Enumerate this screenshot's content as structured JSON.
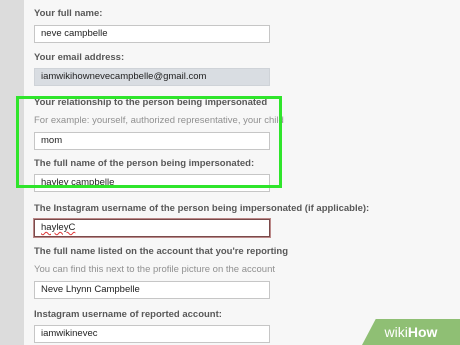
{
  "form": {
    "full_name": {
      "label": "Your full name:",
      "value": "neve campbelle"
    },
    "email": {
      "label": "Your email address:",
      "value": "iamwikihownevecampbelle@gmail.com"
    },
    "relationship": {
      "label": "Your relationship to the person being impersonated",
      "hint": "For example: yourself, authorized representative, your child",
      "value": "mom"
    },
    "impersonated_name": {
      "label": "The full name of the person being impersonated:",
      "value": "hayley campbelle"
    },
    "impersonated_username": {
      "label": "The Instagram username of the person being impersonated (if applicable):",
      "value": "hayleyC"
    },
    "reported_full_name": {
      "label": "The full name listed on the account that you're reporting",
      "hint": "You can find this next to the profile picture on the account",
      "value": "Neve Lhynn Campbelle"
    },
    "reported_username": {
      "label": "Instagram username of reported account:",
      "value": "iamwikinevec"
    }
  },
  "watermark": {
    "wiki": "wiki",
    "how": "How"
  },
  "colors": {
    "highlight": "#2fe52b",
    "watermark": "#8fbf74"
  }
}
